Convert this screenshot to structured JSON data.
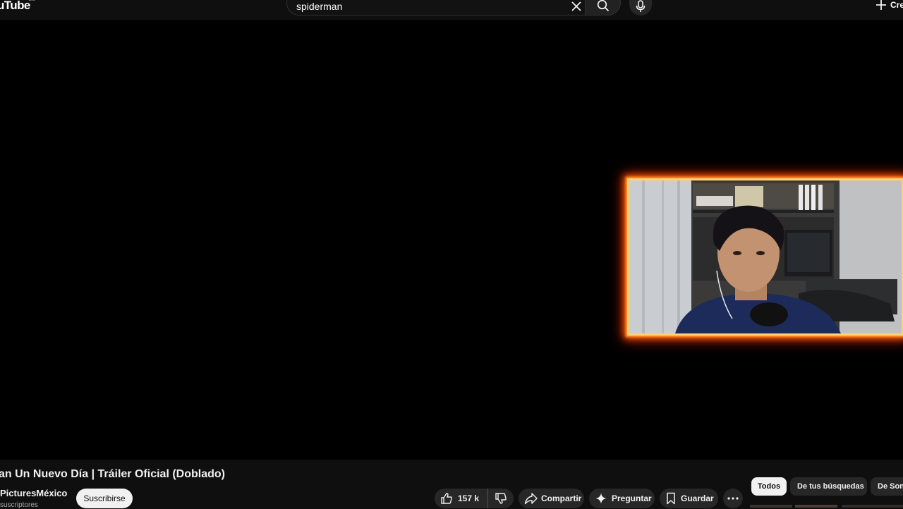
{
  "header": {
    "logo_text": "uTube",
    "logo_sup": "GB",
    "search_value": "spiderman",
    "create_label": "Cre"
  },
  "video": {
    "title": "an Un Nuevo Día | Tráiler Oficial (Doblado)",
    "channel_name": "PicturesMéxico",
    "subscriber_count": "suscriptores",
    "subscribe_label": "Suscribirse"
  },
  "actions": {
    "like_count": "157 k",
    "share_label": "Compartir",
    "ask_label": "Preguntar",
    "save_label": "Guardar"
  },
  "chips": [
    {
      "label": "Todos",
      "active": true
    },
    {
      "label": "De tus búsquedas",
      "active": false
    },
    {
      "label": "De Sony",
      "active": false
    }
  ],
  "icons": {
    "clear": "close-icon",
    "search": "search-icon",
    "mic": "mic-icon",
    "create": "plus-icon",
    "like": "thumbs-up-icon",
    "dislike": "thumbs-down-icon",
    "share": "share-arrow-icon",
    "ask": "sparkle-icon",
    "save": "bookmark-icon",
    "more": "more-horizontal-icon"
  },
  "colors": {
    "background": "#0f0f0f",
    "player_background": "#000000",
    "pill_background": "#272727",
    "fire_border": "#ff5a00"
  }
}
